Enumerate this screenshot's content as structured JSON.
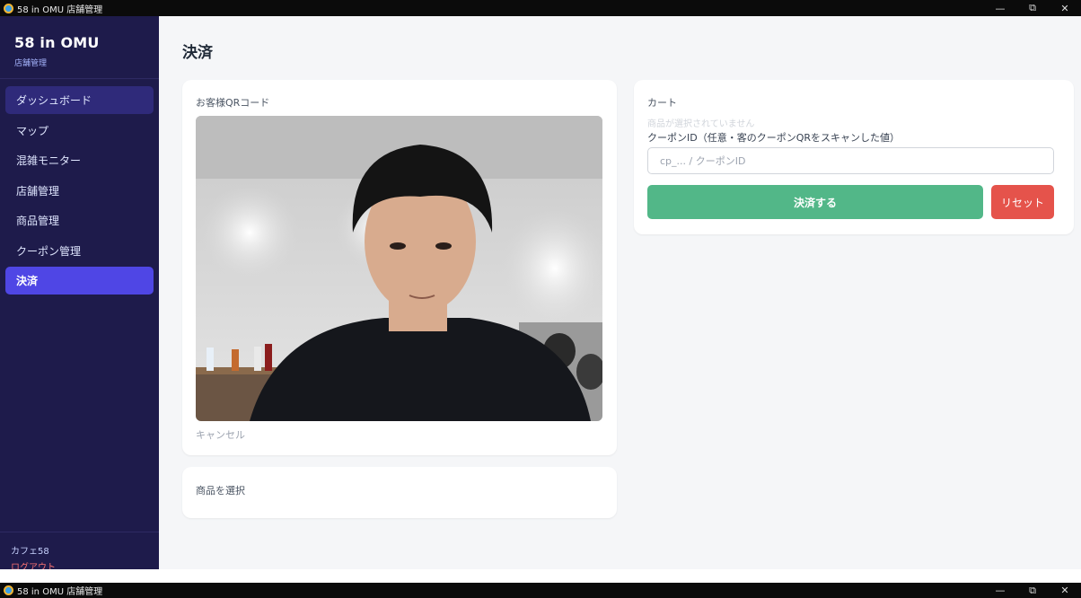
{
  "window": {
    "title": "58 in OMU 店舗管理",
    "minimize_glyph": "—",
    "restore_glyph": "⧉",
    "close_glyph": "✕"
  },
  "sidebar": {
    "brand_name": "58 in OMU",
    "brand_sub": "店舗管理",
    "items": [
      {
        "label": "ダッシュボード",
        "state": "hover"
      },
      {
        "label": "マップ",
        "state": "normal"
      },
      {
        "label": "混雑モニター",
        "state": "normal"
      },
      {
        "label": "店舗管理",
        "state": "normal"
      },
      {
        "label": "商品管理",
        "state": "normal"
      },
      {
        "label": "クーポン管理",
        "state": "normal"
      },
      {
        "label": "決済",
        "state": "active"
      }
    ],
    "store_name": "カフェ58",
    "logout_label": "ログアウト"
  },
  "main": {
    "page_title": "決済",
    "scanner": {
      "label": "お客様QRコード",
      "cancel_label": "キャンセル"
    },
    "products": {
      "label": "商品を選択"
    },
    "cart": {
      "label": "カート",
      "empty_message": "商品が選択されていません",
      "coupon_label": "クーポンID（任意・客のクーポンQRをスキャンした値）",
      "coupon_placeholder": "cp_... / クーポンID",
      "coupon_value": "",
      "pay_label": "決済する",
      "reset_label": "リセット"
    }
  },
  "colors": {
    "sidebar_bg": "#1e1b4b",
    "active_nav": "#4f46e5",
    "pay_button": "#52b788",
    "reset_button": "#e5534b",
    "logout_text": "#f87171"
  }
}
